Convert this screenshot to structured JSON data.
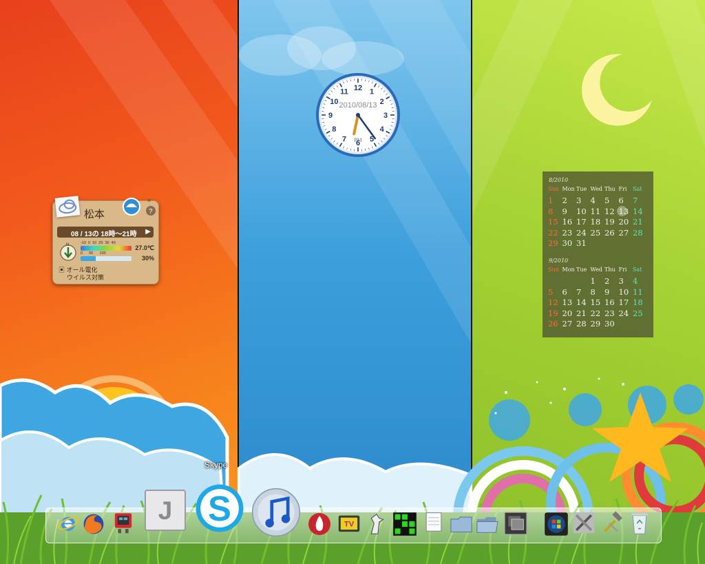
{
  "weather": {
    "city": "松本",
    "date_time": "08 / 13の 18時～21時",
    "temperature": "27.0℃",
    "humidity": "30%",
    "scale_top": "-10  0  10  20  30  40",
    "scale_bottom": "0      50      100",
    "compass_label": "N",
    "footer_line1": "オール電化",
    "footer_line2": "ウイルス対策"
  },
  "clock": {
    "date": "2010/08/13",
    "ampm": "PM",
    "numbers": [
      "12",
      "1",
      "2",
      "3",
      "4",
      "5",
      "6",
      "7",
      "8",
      "9",
      "10",
      "11"
    ],
    "time": "6:24"
  },
  "calendar": {
    "headers": [
      "Sun",
      "Mon",
      "Tue",
      "Wed",
      "Thu",
      "Fri",
      "Sat"
    ],
    "months": [
      {
        "title": "8/2010",
        "weeks": [
          [
            "1",
            "2",
            "3",
            "4",
            "5",
            "6",
            "7"
          ],
          [
            "8",
            "9",
            "10",
            "11",
            "12",
            "13",
            "14"
          ],
          [
            "15",
            "16",
            "17",
            "18",
            "19",
            "20",
            "21"
          ],
          [
            "22",
            "23",
            "24",
            "25",
            "26",
            "27",
            "28"
          ],
          [
            "29",
            "30",
            "31",
            "",
            "",
            "",
            ""
          ]
        ],
        "today": "13"
      },
      {
        "title": "9/2010",
        "weeks": [
          [
            "",
            "",
            "",
            "1",
            "2",
            "3",
            "4"
          ],
          [
            "5",
            "6",
            "7",
            "8",
            "9",
            "10",
            "11"
          ],
          [
            "12",
            "13",
            "14",
            "15",
            "16",
            "17",
            "18"
          ],
          [
            "19",
            "20",
            "21",
            "22",
            "23",
            "24",
            "25"
          ],
          [
            "26",
            "27",
            "28",
            "29",
            "30",
            "",
            ""
          ]
        ]
      }
    ]
  },
  "dock": {
    "tooltip": "Skype",
    "icons": [
      {
        "name": "internet-explorer-icon"
      },
      {
        "name": "firefox-icon"
      },
      {
        "name": "robot-app-icon"
      },
      {
        "name": "j-app-icon"
      },
      {
        "name": "skype-icon"
      },
      {
        "name": "itunes-icon"
      },
      {
        "name": "burn-app-icon"
      },
      {
        "name": "tv-app-icon"
      },
      {
        "name": "counter-strike-icon"
      },
      {
        "name": "green-grid-app-icon"
      },
      {
        "name": "notepad-icon"
      },
      {
        "name": "folder-icon"
      },
      {
        "name": "open-folder-icon"
      },
      {
        "name": "window-switcher-icon"
      },
      {
        "name": "windows-start-icon"
      },
      {
        "name": "tools-icon"
      },
      {
        "name": "hammer-tools-icon"
      },
      {
        "name": "recycle-bin-icon"
      }
    ]
  },
  "colors": {
    "left_panel": "#f25a1c",
    "middle_panel": "#3d9fdc",
    "right_panel": "#a6d233",
    "sunday": "#ff6a3a",
    "saturday": "#5fe0c0"
  }
}
